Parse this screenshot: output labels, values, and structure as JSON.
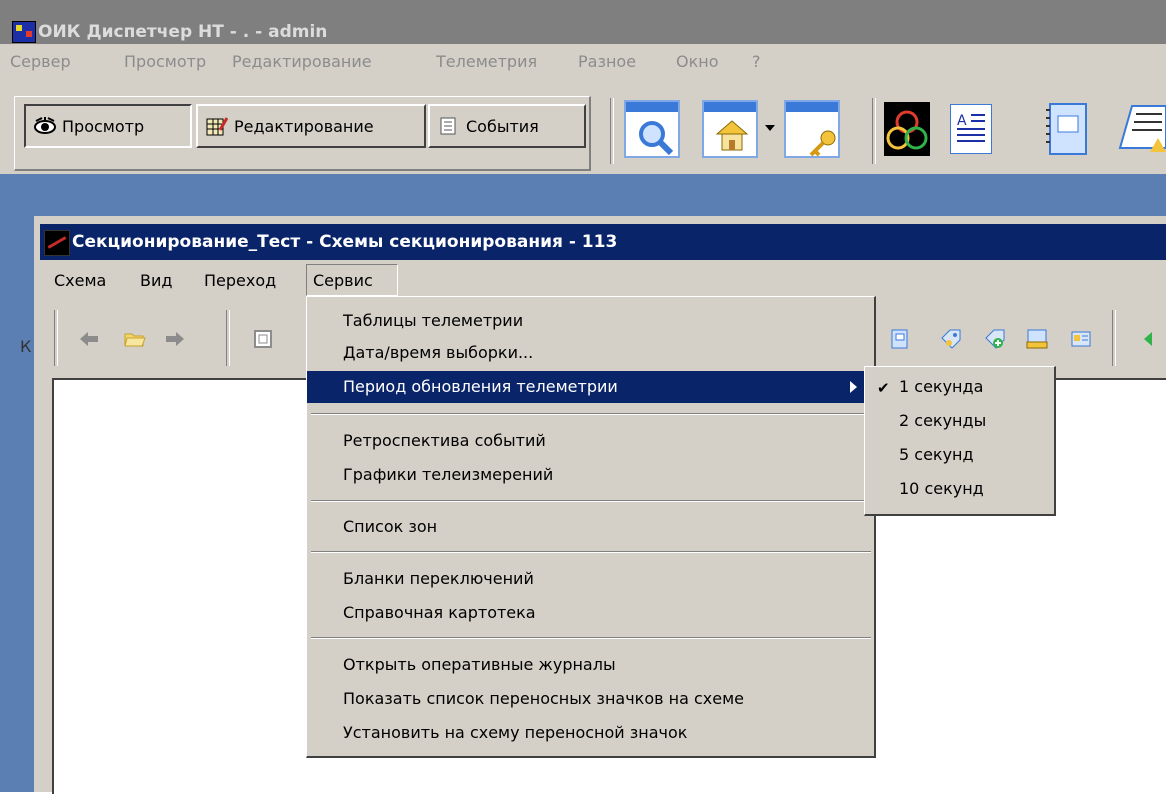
{
  "app": {
    "title": "ОИК Диспетчер НТ - . - admin",
    "menu": [
      "Сервер",
      "Просмотр",
      "Редактирование",
      "Телеметрия",
      "Разное",
      "Окно",
      "?"
    ],
    "view_tabs": [
      {
        "label": "Просмотр",
        "active": true
      },
      {
        "label": "Редактирование",
        "active": false
      },
      {
        "label": "События",
        "active": false
      }
    ]
  },
  "document_window": {
    "title": "Секционирование_Тест - Схемы секционирования - 113",
    "menu": [
      "Схема",
      "Вид",
      "Переход",
      "Сервис"
    ],
    "toolbar_left_glyph": "К",
    "open_menu": "Сервис"
  },
  "service_menu": {
    "groups": [
      [
        "Таблицы телеметрии",
        "Дата/время выборки...",
        "Период обновления телеметрии"
      ],
      [
        "Ретроспектива событий",
        "Графики телеизмерений"
      ],
      [
        "Список зон"
      ],
      [
        "Бланки переключений",
        "Справочная картотека"
      ],
      [
        "Открыть оперативные журналы",
        "Показать список переносных значков на схеме",
        "Установить на схему переносной значок"
      ]
    ],
    "highlighted": "Период обновления телеметрии"
  },
  "update_period_submenu": {
    "items": [
      "1 секунда",
      "2 секунды",
      "5 секунд",
      "10 секунд"
    ],
    "checked": "1 секунда",
    "check_mark": "✔"
  },
  "colors": {
    "active_title": "#0a246a",
    "inactive_title": "#7f7f7f",
    "face": "#d4d0c8",
    "mdi_background": "#5b7fb3"
  }
}
